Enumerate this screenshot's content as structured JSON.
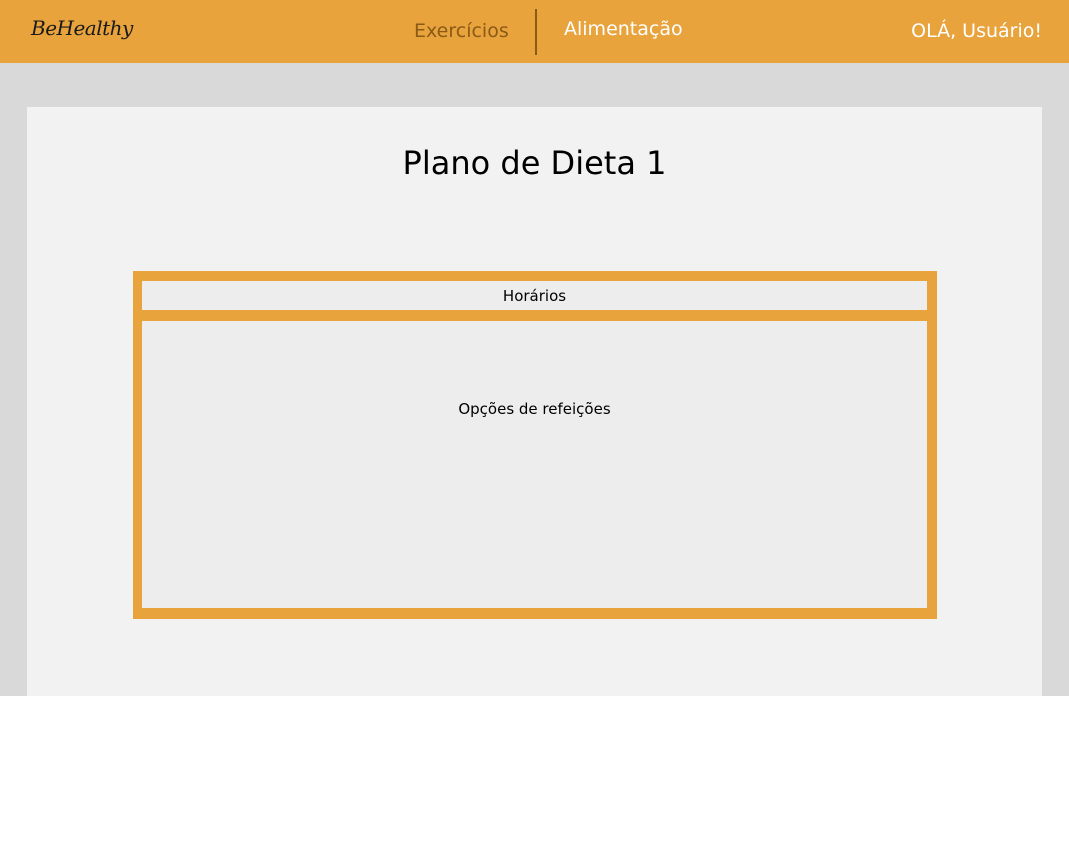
{
  "header": {
    "logo": "BeHealthy",
    "nav": {
      "exercicios": "Exercícios",
      "alimentacao": "Alimentação"
    },
    "greeting": "OLÁ, Usuário!"
  },
  "main": {
    "title": "Plano de Dieta 1",
    "schedule_label": "Horários",
    "meal_options_label": "Opções de refeições"
  },
  "colors": {
    "accent": "#E8A33C",
    "nav_inactive": "#8a5a17",
    "page_background": "#D9D9D9",
    "card_background": "#F2F2F2"
  }
}
